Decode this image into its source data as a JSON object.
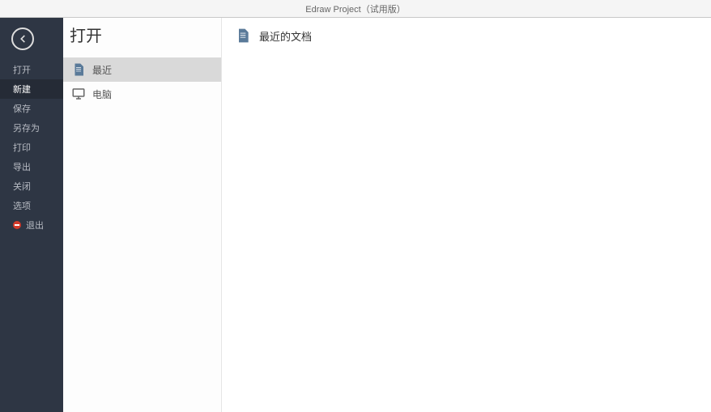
{
  "titlebar": "Edraw Project（试用版）",
  "sidebar": {
    "items": [
      {
        "label": "打开",
        "active": false
      },
      {
        "label": "新建",
        "active": true
      },
      {
        "label": "保存",
        "active": false
      },
      {
        "label": "另存为",
        "active": false
      },
      {
        "label": "打印",
        "active": false
      },
      {
        "label": "导出",
        "active": false
      },
      {
        "label": "关闭",
        "active": false
      },
      {
        "label": "选项",
        "active": false
      },
      {
        "label": "退出",
        "active": false,
        "exit": true
      }
    ]
  },
  "middle": {
    "title": "打开",
    "sources": [
      {
        "label": "最近",
        "selected": true,
        "icon": "document"
      },
      {
        "label": "电脑",
        "selected": false,
        "icon": "monitor"
      }
    ]
  },
  "content": {
    "heading": "最近的文档"
  }
}
